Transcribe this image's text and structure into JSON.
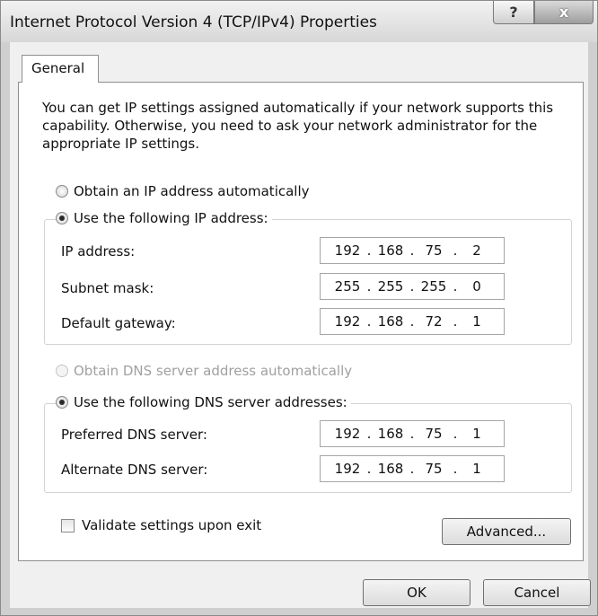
{
  "window": {
    "title": "Internet Protocol Version 4 (TCP/IPv4) Properties",
    "help_glyph": "?",
    "close_glyph": "x"
  },
  "tabs": [
    {
      "label": "General"
    }
  ],
  "description": "You can get IP settings assigned automatically if your network supports this capability. Otherwise, you need to ask your network administrator for the appropriate IP settings.",
  "ip_section": {
    "auto_label": "Obtain an IP address automatically",
    "auto_selected": false,
    "manual_label": "Use the following IP address:",
    "manual_selected": true,
    "fields": [
      {
        "label": "IP address:",
        "octets": [
          "192",
          "168",
          "75",
          "2"
        ]
      },
      {
        "label": "Subnet mask:",
        "octets": [
          "255",
          "255",
          "255",
          "0"
        ]
      },
      {
        "label": "Default gateway:",
        "octets": [
          "192",
          "168",
          "72",
          "1"
        ]
      }
    ]
  },
  "dns_section": {
    "auto_label": "Obtain DNS server address automatically",
    "auto_selected": false,
    "auto_disabled": true,
    "manual_label": "Use the following DNS server addresses:",
    "manual_selected": true,
    "fields": [
      {
        "label": "Preferred DNS server:",
        "octets": [
          "192",
          "168",
          "75",
          "1"
        ]
      },
      {
        "label": "Alternate DNS server:",
        "octets": [
          "192",
          "168",
          "75",
          "1"
        ]
      }
    ]
  },
  "validate_label": "Validate settings upon exit",
  "validate_checked": false,
  "buttons": {
    "advanced": "Advanced...",
    "ok": "OK",
    "cancel": "Cancel"
  }
}
